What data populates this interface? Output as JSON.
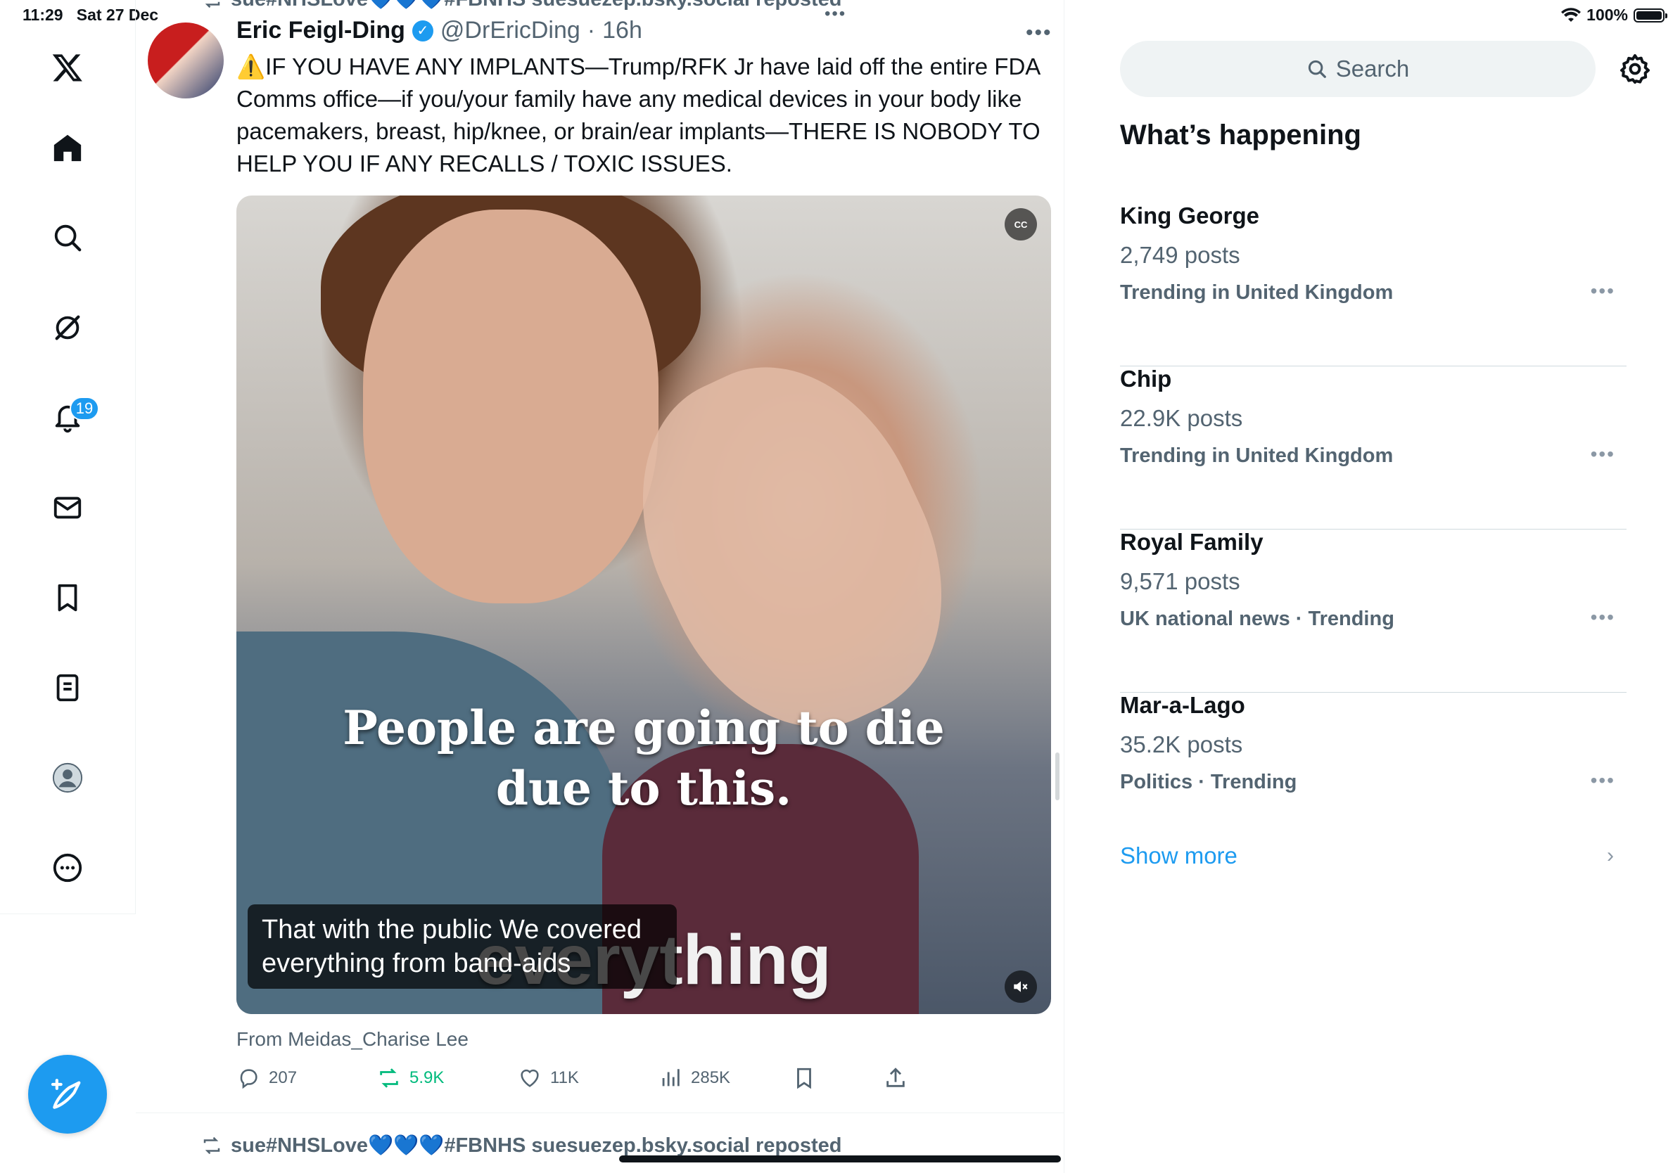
{
  "status_bar": {
    "time": "11:29",
    "date": "Sat 27 Dec",
    "battery": "100%",
    "battery_level": 1.0
  },
  "nav": {
    "items": [
      "x-logo",
      "home",
      "search",
      "grok",
      "notifications",
      "messages",
      "bookmarks",
      "lists",
      "profile",
      "more"
    ],
    "notifications_badge": "19"
  },
  "timeline": {
    "top_repost_line": "sue#NHSLove💙💙💙#FBNHS suesuezep.bsky.social reposted",
    "top_dots": "•••",
    "tweet": {
      "author_name": "Eric Feigl-Ding",
      "handle": "@DrEricDing",
      "sep": "·",
      "time": "16h",
      "more": "•••",
      "text": "⚠️IF YOU HAVE ANY IMPLANTS—Trump/RFK Jr have laid off the entire FDA Comms office—if you/your family have any medical devices in your body like pacemakers, breast, hip/knee, or brain/ear implants—THERE IS NOBODY TO HELP YOU IF ANY RECALLS / TOXIC ISSUES.",
      "media": {
        "cc_label": "CC",
        "burned_caption_line1": "People are going to die",
        "burned_caption_line2": "due to this.",
        "burned_word": "everything",
        "subtitle": "That with the public We covered everything from band-aids"
      },
      "from": "From Meidas_Charise Lee",
      "actions": {
        "replies": "207",
        "reposts": "5.9K",
        "likes": "11K",
        "views": "285K"
      }
    },
    "next_repost_line": "sue#NHSLove💙💙💙#FBNHS suesuezep.bsky.social reposted"
  },
  "sidebar": {
    "search_placeholder": "Search",
    "section_title": "What’s happening",
    "trends": [
      {
        "name": "King George",
        "count": "2,749 posts",
        "context": "Trending in United Kingdom"
      },
      {
        "name": "Chip",
        "count": "22.9K posts",
        "context": "Trending in United Kingdom"
      },
      {
        "name": "Royal Family",
        "count": "9,571 posts",
        "context": "UK national news · Trending"
      },
      {
        "name": "Mar-a-Lago",
        "count": "35.2K posts",
        "context": "Politics · Trending"
      }
    ],
    "trend_more": "•••",
    "show_more": "Show more",
    "show_more_chevron": "›"
  },
  "colors": {
    "accent": "#1d9bf0",
    "repost_green": "#00ba7c",
    "muted": "#536471"
  }
}
